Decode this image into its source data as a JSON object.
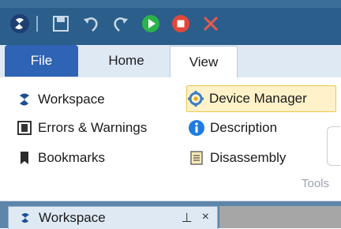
{
  "qat": {
    "icons": [
      "app-logo-icon",
      "save-icon",
      "undo-icon",
      "redo-icon",
      "run-icon",
      "stop-icon",
      "close-icon"
    ]
  },
  "ribbon": {
    "tabs": [
      {
        "label": "File"
      },
      {
        "label": "Home"
      },
      {
        "label": "View"
      }
    ],
    "col1": [
      {
        "label": "Workspace",
        "icon": "workspace-icon"
      },
      {
        "label": "Errors & Warnings",
        "icon": "errors-warnings-icon"
      },
      {
        "label": "Bookmarks",
        "icon": "bookmark-icon"
      }
    ],
    "col2": [
      {
        "label": "Device Manager",
        "icon": "device-manager-icon",
        "selected": true
      },
      {
        "label": "Description",
        "icon": "info-icon"
      },
      {
        "label": "Disassembly",
        "icon": "disassembly-icon"
      }
    ],
    "group_label": "Tools"
  },
  "panel": {
    "tab_label": "Workspace",
    "pin_glyph": "⊥",
    "close_glyph": "×"
  },
  "colors": {
    "title_bar": "#2b5e8a",
    "file_tab": "#2f63b3",
    "selected_item_bg": "#fff2c9"
  }
}
